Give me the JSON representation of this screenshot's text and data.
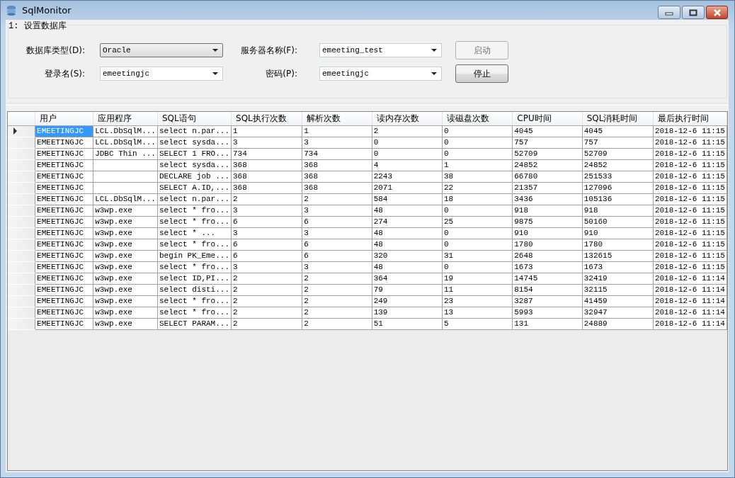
{
  "window": {
    "title": "SqlMonitor"
  },
  "settings": {
    "legend": "1: 设置数据库",
    "db_type": {
      "label": "数据库类型(D):",
      "value": "Oracle"
    },
    "server": {
      "label": "服务器名称(F):",
      "value": "emeeting_test"
    },
    "login": {
      "label": "登录名(S):",
      "value": "emeetingjc"
    },
    "password": {
      "label": "密码(P):",
      "value": "emeetingjc"
    },
    "buttons": [
      {
        "label": "启动",
        "disabled": true
      },
      {
        "label": "停止",
        "disabled": false
      }
    ]
  },
  "table": {
    "columns": [
      "用户",
      "应用程序",
      "SQL语句",
      "SQL执行次数",
      "解析次数",
      "读内存次数",
      "读磁盘次数",
      "CPU时间",
      "SQL消耗时间",
      "最后执行时间"
    ],
    "rows": [
      {
        "selected": true,
        "user": "EMEETINGJC",
        "application": "LCL.DbSqlM...",
        "sql": "select n.par...",
        "exec_count": "1",
        "parse_count": "1",
        "memory_reads": "2",
        "disk_reads": "0",
        "cpu_time": "4045",
        "sql_time": "4045",
        "last_exec": "2018-12-6 11:15"
      },
      {
        "selected": false,
        "user": "EMEETINGJC",
        "application": "LCL.DbSqlM...",
        "sql": "select sysda...",
        "exec_count": "3",
        "parse_count": "3",
        "memory_reads": "0",
        "disk_reads": "0",
        "cpu_time": "757",
        "sql_time": "757",
        "last_exec": "2018-12-6 11:15"
      },
      {
        "selected": false,
        "user": "EMEETINGJC",
        "application": "JDBC Thin ...",
        "sql": "SELECT 1 FRO...",
        "exec_count": "734",
        "parse_count": "734",
        "memory_reads": "0",
        "disk_reads": "0",
        "cpu_time": "52709",
        "sql_time": "52709",
        "last_exec": "2018-12-6 11:15"
      },
      {
        "selected": false,
        "user": "EMEETINGJC",
        "sql": "select sysda...",
        "exec_count": "368",
        "parse_count": "368",
        "memory_reads": "4",
        "disk_reads": "1",
        "cpu_time": "24852",
        "sql_time": "24852",
        "last_exec": "2018-12-6 11:15"
      },
      {
        "selected": false,
        "user": "EMEETINGJC",
        "sql": "DECLARE job ...",
        "exec_count": "368",
        "parse_count": "368",
        "memory_reads": "2243",
        "disk_reads": "38",
        "cpu_time": "66780",
        "sql_time": "251533",
        "last_exec": "2018-12-6 11:15"
      },
      {
        "selected": false,
        "user": "EMEETINGJC",
        "sql": "SELECT A.ID,...",
        "exec_count": "368",
        "parse_count": "368",
        "memory_reads": "2071",
        "disk_reads": "22",
        "cpu_time": "21357",
        "sql_time": "127096",
        "last_exec": "2018-12-6 11:15"
      },
      {
        "selected": false,
        "user": "EMEETINGJC",
        "application": "LCL.DbSqlM...",
        "sql": "select n.par...",
        "exec_count": "2",
        "parse_count": "2",
        "memory_reads": "584",
        "disk_reads": "18",
        "cpu_time": "3436",
        "sql_time": "105136",
        "last_exec": "2018-12-6 11:15"
      },
      {
        "selected": false,
        "user": "EMEETINGJC",
        "application": "w3wp.exe",
        "sql": "select * fro...",
        "exec_count": "3",
        "parse_count": "3",
        "memory_reads": "48",
        "disk_reads": "0",
        "cpu_time": "918",
        "sql_time": "918",
        "last_exec": "2018-12-6 11:15"
      },
      {
        "selected": false,
        "user": "EMEETINGJC",
        "application": "w3wp.exe",
        "sql": "select * fro...",
        "exec_count": "6",
        "parse_count": "6",
        "memory_reads": "274",
        "disk_reads": "25",
        "cpu_time": "9875",
        "sql_time": "50160",
        "last_exec": "2018-12-6 11:15"
      },
      {
        "selected": false,
        "user": "EMEETINGJC",
        "application": "w3wp.exe",
        "sql": "select  *   ...",
        "exec_count": "3",
        "parse_count": "3",
        "memory_reads": "48",
        "disk_reads": "0",
        "cpu_time": "910",
        "sql_time": "910",
        "last_exec": "2018-12-6 11:15"
      },
      {
        "selected": false,
        "user": "EMEETINGJC",
        "application": "w3wp.exe",
        "sql": "select * fro...",
        "exec_count": "6",
        "parse_count": "6",
        "memory_reads": "48",
        "disk_reads": "0",
        "cpu_time": "1780",
        "sql_time": "1780",
        "last_exec": "2018-12-6 11:15"
      },
      {
        "selected": false,
        "user": "EMEETINGJC",
        "application": "w3wp.exe",
        "sql": "begin PK_Eme...",
        "exec_count": "6",
        "parse_count": "6",
        "memory_reads": "320",
        "disk_reads": "31",
        "cpu_time": "2648",
        "sql_time": "132615",
        "last_exec": "2018-12-6 11:15"
      },
      {
        "selected": false,
        "user": "EMEETINGJC",
        "application": "w3wp.exe",
        "sql": "select * fro...",
        "exec_count": "3",
        "parse_count": "3",
        "memory_reads": "48",
        "disk_reads": "0",
        "cpu_time": "1673",
        "sql_time": "1673",
        "last_exec": "2018-12-6 11:15"
      },
      {
        "selected": false,
        "user": "EMEETINGJC",
        "application": "w3wp.exe",
        "sql": "select ID,PI...",
        "exec_count": "2",
        "parse_count": "2",
        "memory_reads": "364",
        "disk_reads": "19",
        "cpu_time": "14745",
        "sql_time": "32419",
        "last_exec": "2018-12-6 11:14"
      },
      {
        "selected": false,
        "user": "EMEETINGJC",
        "application": "w3wp.exe",
        "sql": "select disti...",
        "exec_count": "2",
        "parse_count": "2",
        "memory_reads": "79",
        "disk_reads": "11",
        "cpu_time": "8154",
        "sql_time": "32115",
        "last_exec": "2018-12-6 11:14"
      },
      {
        "selected": false,
        "user": "EMEETINGJC",
        "application": "w3wp.exe",
        "sql": "select * fro...",
        "exec_count": "2",
        "parse_count": "2",
        "memory_reads": "249",
        "disk_reads": "23",
        "cpu_time": "3287",
        "sql_time": "41459",
        "last_exec": "2018-12-6 11:14"
      },
      {
        "selected": false,
        "user": "EMEETINGJC",
        "application": "w3wp.exe",
        "sql": "select * fro...",
        "exec_count": "2",
        "parse_count": "2",
        "memory_reads": "139",
        "disk_reads": "13",
        "cpu_time": "5993",
        "sql_time": "32947",
        "last_exec": "2018-12-6 11:14"
      },
      {
        "selected": false,
        "user": "EMEETINGJC",
        "application": "w3wp.exe",
        "sql": "SELECT PARAM...",
        "exec_count": "2",
        "parse_count": "2",
        "memory_reads": "51",
        "disk_reads": "5",
        "cpu_time": "131",
        "sql_time": "24889",
        "last_exec": "2018-12-6 11:14"
      }
    ]
  }
}
